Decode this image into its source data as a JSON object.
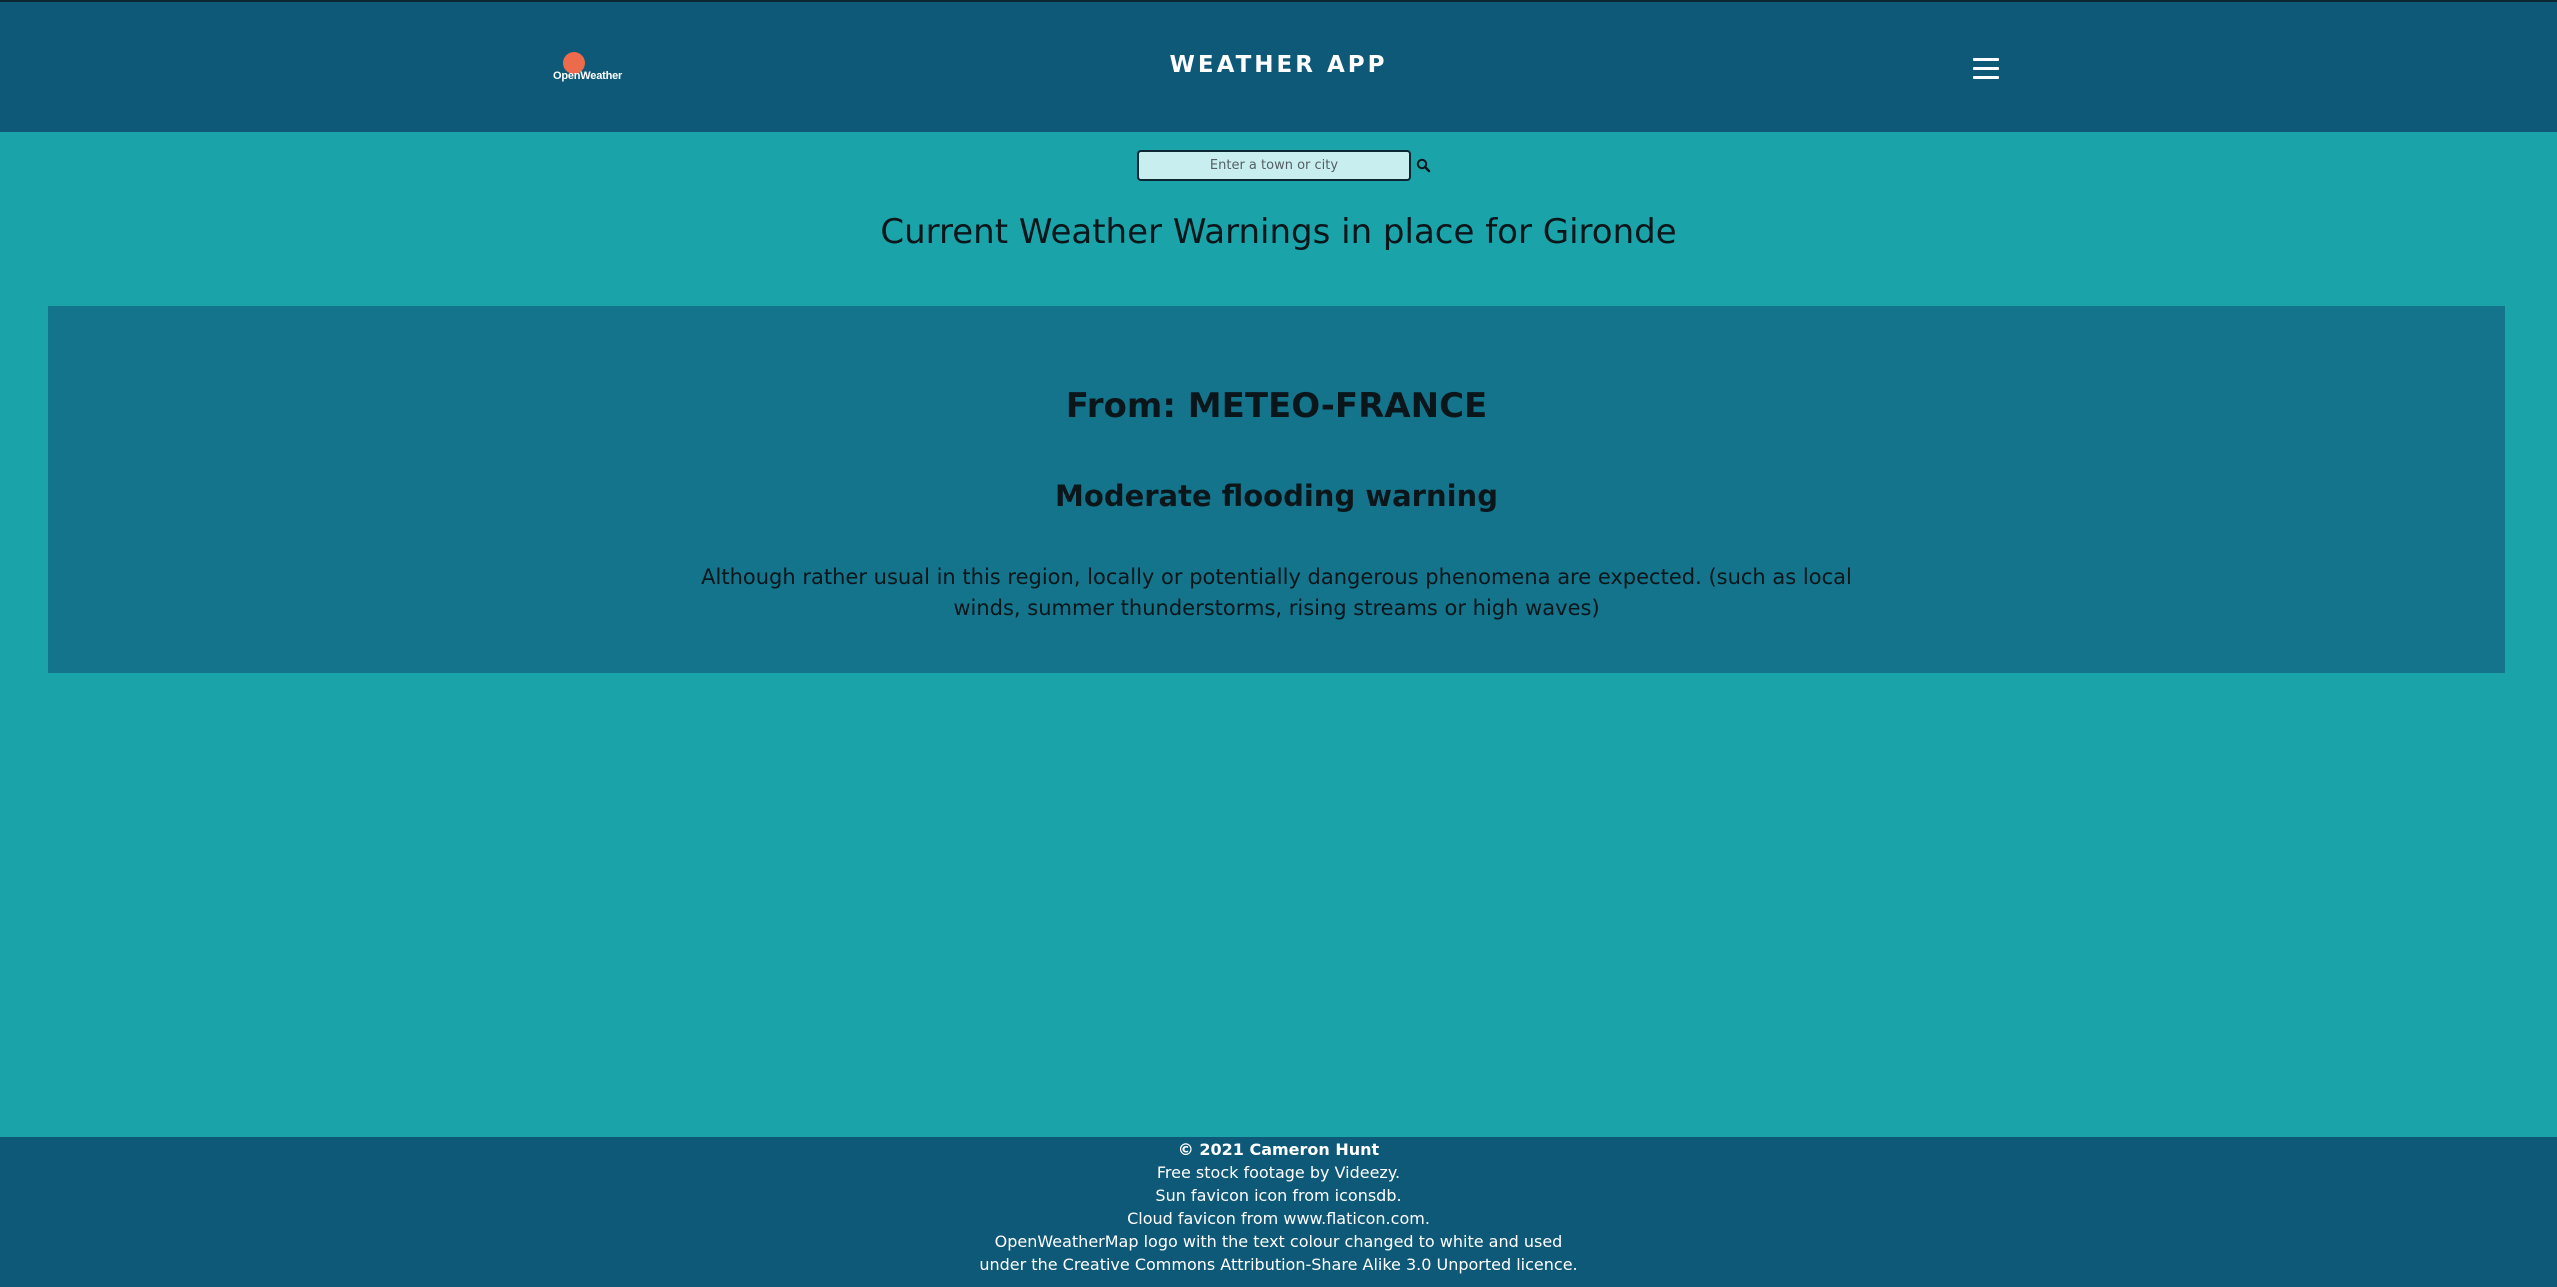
{
  "header": {
    "logo_text": "OpenWeather",
    "title": "WEATHER APP",
    "menu_icon": "hamburger-menu-icon"
  },
  "search": {
    "placeholder": "Enter a town or city",
    "value": "",
    "icon": "search-icon"
  },
  "main": {
    "title": "Current Weather Warnings in place for Gironde"
  },
  "warning": {
    "source": "From: METEO-FRANCE",
    "title": "Moderate flooding warning",
    "description": "Although rather usual in this region, locally or potentially dangerous phenomena are expected. (such as local winds, summer thunderstorms, rising streams or high waves)"
  },
  "footer": {
    "copyright": "© 2021 Cameron Hunt",
    "lines": [
      "Free stock footage by Videezy.",
      "Sun favicon icon from iconsdb.",
      "Cloud favicon from www.flaticon.com.",
      "OpenWeatherMap logo with the text colour changed to white and used",
      "under the Creative Commons Attribution-Share Alike 3.0 Unported licence."
    ]
  },
  "colors": {
    "page_background": "#1aa3a8",
    "header_background": "#0e5878",
    "panel_background": "#13748b",
    "logo_accent": "#eb6b4c"
  }
}
